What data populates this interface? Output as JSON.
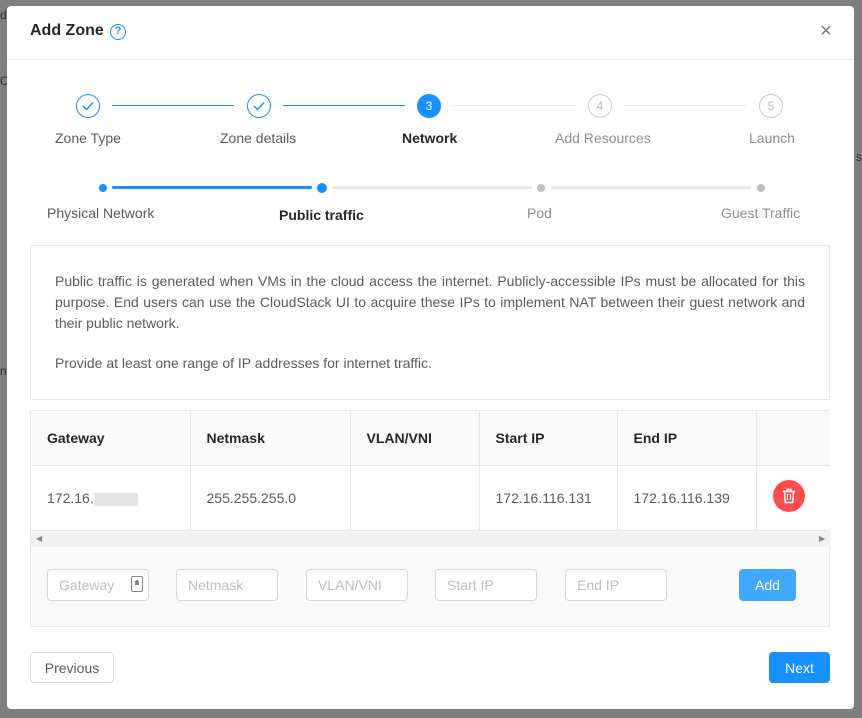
{
  "backdrop": {
    "top_left_fragment": "d",
    "left_fragment_1": "C",
    "left_fragment_2": "n",
    "right_fragment": "s"
  },
  "modal": {
    "title": "Add Zone",
    "help_icon": "question-circle-icon",
    "close_icon": "close-icon"
  },
  "steps": [
    {
      "label": "Zone Type",
      "number": "1",
      "status": "done"
    },
    {
      "label": "Zone details",
      "number": "2",
      "status": "done"
    },
    {
      "label": "Network",
      "number": "3",
      "status": "active"
    },
    {
      "label": "Add Resources",
      "number": "4",
      "status": "wait"
    },
    {
      "label": "Launch",
      "number": "5",
      "status": "wait"
    }
  ],
  "substeps": [
    {
      "label": "Physical Network",
      "status": "done"
    },
    {
      "label": "Public traffic",
      "status": "active"
    },
    {
      "label": "Pod",
      "status": "wait"
    },
    {
      "label": "Guest Traffic",
      "status": "wait"
    }
  ],
  "info": {
    "paragraph1": "Public traffic is generated when VMs in the cloud access the internet. Publicly-accessible IPs must be allocated for this purpose. End users can use the CloudStack UI to acquire these IPs to implement NAT between their guest network and their public network.",
    "paragraph2": "Provide at least one range of IP addresses for internet traffic."
  },
  "table": {
    "columns": [
      "Gateway",
      "Netmask",
      "VLAN/VNI",
      "Start IP",
      "End IP",
      ""
    ],
    "rows": [
      {
        "gateway": "172.16.",
        "netmask": "255.255.255.0",
        "vlan": "",
        "start_ip": "172.16.116.131",
        "end_ip": "172.16.116.139"
      }
    ]
  },
  "form": {
    "gateway_placeholder": "Gateway",
    "netmask_placeholder": "Netmask",
    "vlan_placeholder": "VLAN/VNI",
    "start_ip_placeholder": "Start IP",
    "end_ip_placeholder": "End IP",
    "add_label": "Add"
  },
  "footer": {
    "previous_label": "Previous",
    "next_label": "Next"
  },
  "colors": {
    "primary": "#1890ff",
    "danger": "#ff4d4f",
    "add_button": "#40a9ff"
  }
}
